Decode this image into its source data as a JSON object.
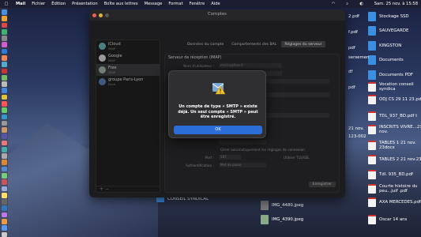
{
  "menubar": {
    "app": "Mail",
    "items": [
      "Fichier",
      "Édition",
      "Présentation",
      "Boîte aux lettres",
      "Message",
      "Format",
      "Fenêtre",
      "Aide"
    ],
    "datetime": "Sam. 25 nov. à 15:58"
  },
  "window": {
    "title": "Comptes",
    "tabs": [
      "Données du compte",
      "Comportements des BAL",
      "Réglages du serveur"
    ],
    "accounts": [
      {
        "name": "iCloud",
        "type": "IMAP"
      },
      {
        "name": "Google",
        "type": "IMAP"
      },
      {
        "name": "Free",
        "type": "IMAP"
      },
      {
        "name": "groupe Paris-Lyon",
        "type": "Exch"
      }
    ],
    "form": {
      "section": "Serveur de réception (IMAP)",
      "user_label": "Nom d'utilisateur :",
      "user_value": "micilia@free.fr",
      "mdp_label": "Mot de passe :",
      "host_label": "Nom d'hôte :",
      "auto_label": "Gérer automatiquement les réglages de connexion",
      "port_label": "Port :",
      "port_value": "587",
      "tls_label": "Utiliser TLS/SSL",
      "auth_label": "Authentification :",
      "auth_value": "Mot de passe",
      "save": "Enregistrer"
    }
  },
  "dialog": {
    "message": "Un compte de type « SMTP » existe déjà. Un seul compte « SMTP » peut être enregistré.",
    "ok": "OK"
  },
  "desktop_right": [
    {
      "label": "Stockage SSD"
    },
    {
      "label": "SAUVEGARDE"
    },
    {
      "label": "KINGSTON"
    },
    {
      "label": "Documents"
    },
    {
      "label": "Documents PDF"
    },
    {
      "label": "Vocation conseil syndica"
    },
    {
      "label": "ODJ CS 29 11 23.pdf"
    },
    {
      "label": "TDL_937_BD.pdf t"
    },
    {
      "label": "INSCRITS VIVRE...21 nov."
    },
    {
      "label": "TABLES 1 21 nov. 23docx"
    },
    {
      "label": "TABLES 2 21 nov.23"
    },
    {
      "label": "Tdl. 935_BD.pdf"
    },
    {
      "label": "Courte histoire du peu...juif .pdf"
    },
    {
      "label": "AXA MERCEDES.pdf"
    },
    {
      "label": "Oscar 14 ans"
    }
  ],
  "desktop_mid": [
    {
      "label": "2.pdf"
    },
    {
      "label": "f.pdf"
    },
    {
      "label": "pdf"
    },
    {
      "label": "sersemen"
    },
    {
      "label": "df"
    },
    {
      "label": "pdf"
    },
    {
      "label": "21 nov."
    },
    {
      "label": "123-002"
    }
  ],
  "desktop_bottom": [
    {
      "label": "CONSEIL SYNDICAL"
    },
    {
      "label": "IMG_4480.jpeg"
    },
    {
      "label": "IMG_4390.jpeg"
    }
  ]
}
